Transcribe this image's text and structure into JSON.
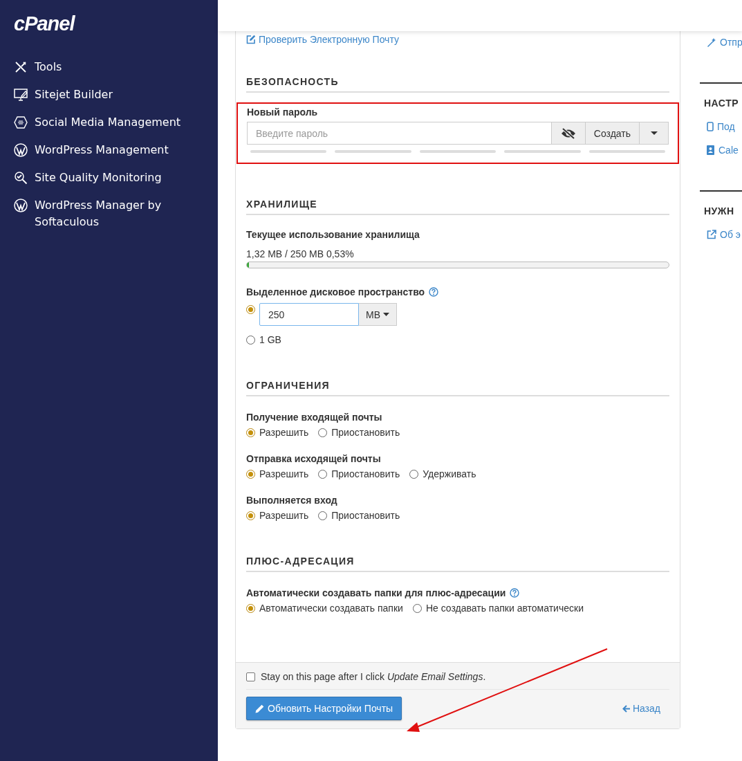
{
  "sidebar": {
    "logo": "cPanel",
    "items": [
      {
        "label": "Tools"
      },
      {
        "label": "Sitejet Builder"
      },
      {
        "label": "Social Media Management"
      },
      {
        "label": "WordPress Management"
      },
      {
        "label": "Site Quality Monitoring"
      },
      {
        "label": "WordPress Manager by Softaculous"
      }
    ]
  },
  "top_link": "Проверить Электронную Почту",
  "sections": [
    {
      "kind": "password",
      "title": "БЕЗОПАСНОСТЬ",
      "label": "Новый пароль",
      "placeholder": "Введите пароль",
      "generate": "Создать"
    },
    {
      "kind": "storage",
      "title": "ХРАНИЛИЩЕ",
      "usage_label": "Текущее использование хранилища",
      "usage_text": "1,32 MB / 250 MB 0,53%",
      "level": 0.0053,
      "quota_label": "Выделенное дисковое пространство",
      "options": [
        {
          "kind": "custom",
          "value": "250",
          "unit": "MB",
          "selected": true
        },
        {
          "kind": "fixed",
          "label": "1 GB",
          "selected": false
        }
      ]
    },
    {
      "kind": "radios",
      "title": "ОГРАНИЧЕНИЯ",
      "groups": [
        {
          "label": "Получение входящей почты",
          "help": false,
          "options": [
            {
              "label": "Разрешить",
              "selected": true
            },
            {
              "label": "Приостановить",
              "selected": false
            }
          ]
        },
        {
          "label": "Отправка исходящей почты",
          "help": false,
          "options": [
            {
              "label": "Разрешить",
              "selected": true
            },
            {
              "label": "Приостановить",
              "selected": false
            },
            {
              "label": "Удерживать",
              "selected": false
            }
          ]
        },
        {
          "label": "Выполняется вход",
          "help": false,
          "options": [
            {
              "label": "Разрешить",
              "selected": true
            },
            {
              "label": "Приостановить",
              "selected": false
            }
          ]
        }
      ]
    },
    {
      "kind": "radios",
      "title": "ПЛЮС-АДРЕСАЦИЯ",
      "groups": [
        {
          "label": "Автоматически создавать папки для плюс-адресации",
          "help": true,
          "options": [
            {
              "label": "Автоматически создавать папки",
              "selected": true
            },
            {
              "label": "Не создавать папки автоматически",
              "selected": false
            }
          ]
        }
      ]
    }
  ],
  "footer": {
    "stay": {
      "text": "Stay on this page after I click *Update Email Settings*.",
      "checked": false
    },
    "submit": "Обновить Настройки Почты",
    "back": "Назад"
  },
  "right": {
    "link": "Отпр",
    "sections": [
      {
        "title": "НАСТР",
        "links": [
          "Под",
          "Cale"
        ]
      },
      {
        "title": "НУЖН",
        "links": [
          "Об э"
        ]
      }
    ]
  }
}
